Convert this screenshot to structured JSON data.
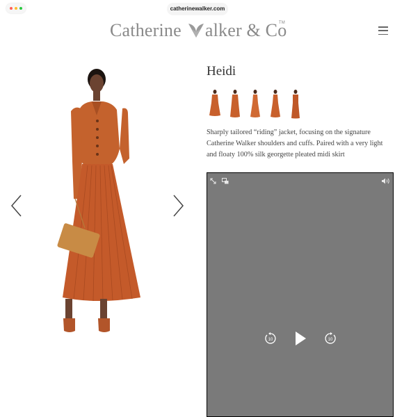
{
  "browser": {
    "url": "catherinewalker.com",
    "dot_colors": [
      "#ff5f57",
      "#febc2e",
      "#28c840"
    ]
  },
  "header": {
    "brand_left": "Catherine",
    "brand_right": "alker & Co",
    "trademark": "TM",
    "menu_icon": "hamburger-icon"
  },
  "gallery": {
    "prev_icon": "chevron-left-icon",
    "next_icon": "chevron-right-icon",
    "garment_color": "#c4622d"
  },
  "product": {
    "name": "Heidi",
    "thumbnail_count": 5,
    "description": "Sharply tailored “riding” jacket, focusing on the signature Catherine Walker shoulders and cuffs. Paired with a very light and floaty 100% silk georgette pleated midi skirt"
  },
  "video": {
    "background": "#7a7a7a",
    "skip_back_label": "10",
    "skip_forward_label": "10",
    "icons": [
      "expand-icon",
      "picture-in-picture-icon",
      "volume-icon",
      "skip-back-icon",
      "play-icon",
      "skip-forward-icon"
    ]
  }
}
